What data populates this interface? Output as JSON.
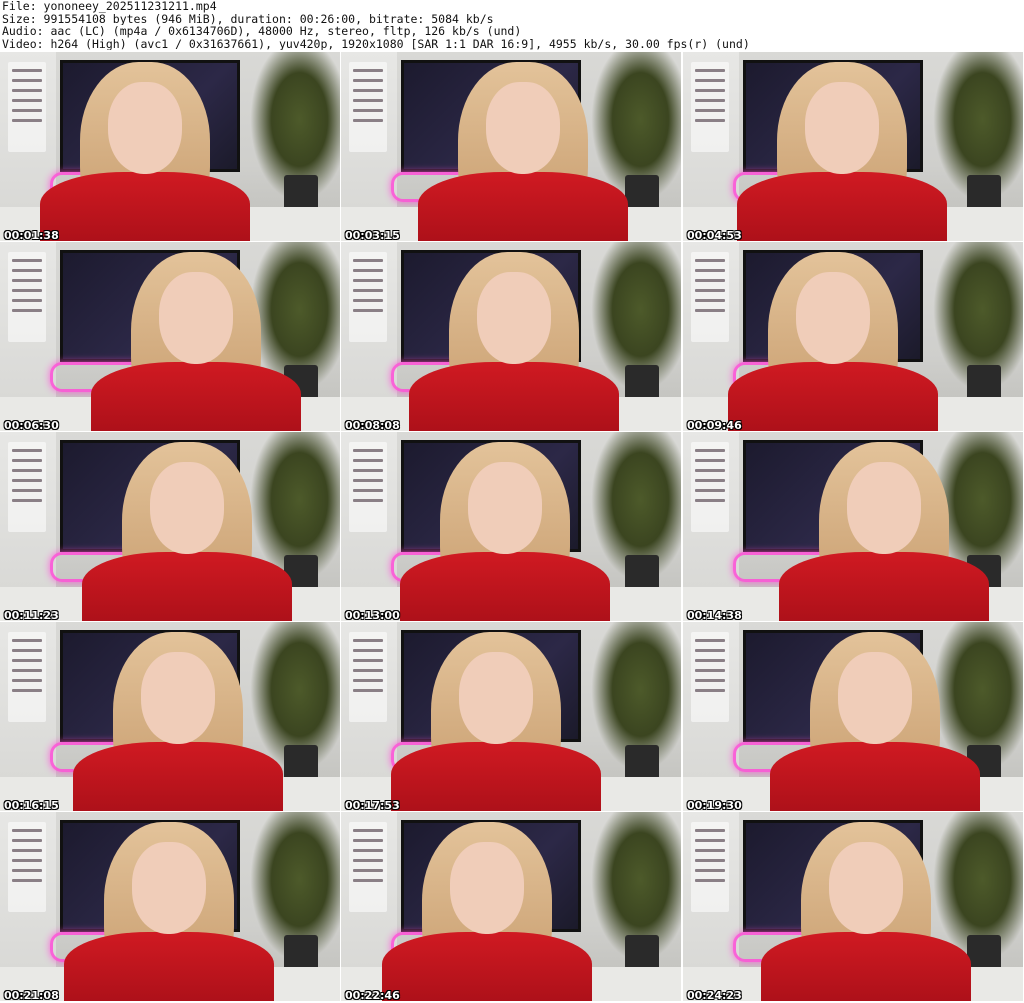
{
  "header": {
    "file_line": "File: yononeey_202511231211.mp4",
    "size_line": "Size: 991554108 bytes (946 MiB), duration: 00:26:00, bitrate: 5084 kb/s",
    "audio_line": "Audio: aac (LC) (mp4a / 0x6134706D), 48000 Hz, stereo, fltp, 126 kb/s (und)",
    "video_line": "Video: h264 (High) (avc1 / 0x31637661), yuv420p, 1920x1080 [SAR 1:1 DAR 16:9], 4955 kb/s, 30.00 fps(r) (und)"
  },
  "thumbnails": [
    {
      "timestamp": "00:01:38"
    },
    {
      "timestamp": "00:03:15"
    },
    {
      "timestamp": "00:04:53"
    },
    {
      "timestamp": "00:06:30"
    },
    {
      "timestamp": "00:08:08"
    },
    {
      "timestamp": "00:09:46"
    },
    {
      "timestamp": "00:11:23"
    },
    {
      "timestamp": "00:13:00"
    },
    {
      "timestamp": "00:14:38"
    },
    {
      "timestamp": "00:16:15"
    },
    {
      "timestamp": "00:17:53"
    },
    {
      "timestamp": "00:19:30"
    },
    {
      "timestamp": "00:21:08"
    },
    {
      "timestamp": "00:22:46"
    },
    {
      "timestamp": "00:24:23"
    }
  ]
}
